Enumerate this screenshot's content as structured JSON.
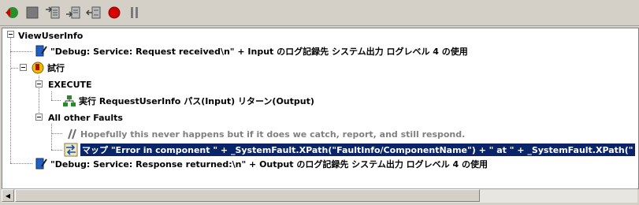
{
  "toolbar": {
    "buttons": [
      {
        "name": "run-icon"
      },
      {
        "name": "stop-icon"
      },
      {
        "name": "step-into-icon"
      },
      {
        "name": "step-over-icon"
      },
      {
        "name": "step-out-icon"
      },
      {
        "name": "breakpoint-icon"
      },
      {
        "name": "pause-icon"
      }
    ]
  },
  "tree": {
    "root": "ViewUserInfo",
    "log1": "\"Debug: Service: Request received\\n\" + Input のログ記録先 システム出力 ログレベル 4 の使用",
    "try": "試行",
    "execute": "EXECUTE",
    "invoke": "実行 RequestUserInfo パス(Input) リターン(Output)",
    "all_faults": "All other Faults",
    "comment": "Hopefully this never happens but if it does we catch, report, and still respond.",
    "map": "マップ \"Error in component \" + _SystemFault.XPath(\"FaultInfo/ComponentName\") + \" at \" + _SystemFault.XPath(\"",
    "log2": "\"Debug: Service: Response returned:\\n\" + Output のログ記録先 システム出力 ログレベル 4 の使用"
  },
  "colors": {
    "selection": "#0a246a",
    "comment": "#808080",
    "window_bg": "#d4d0c8"
  }
}
